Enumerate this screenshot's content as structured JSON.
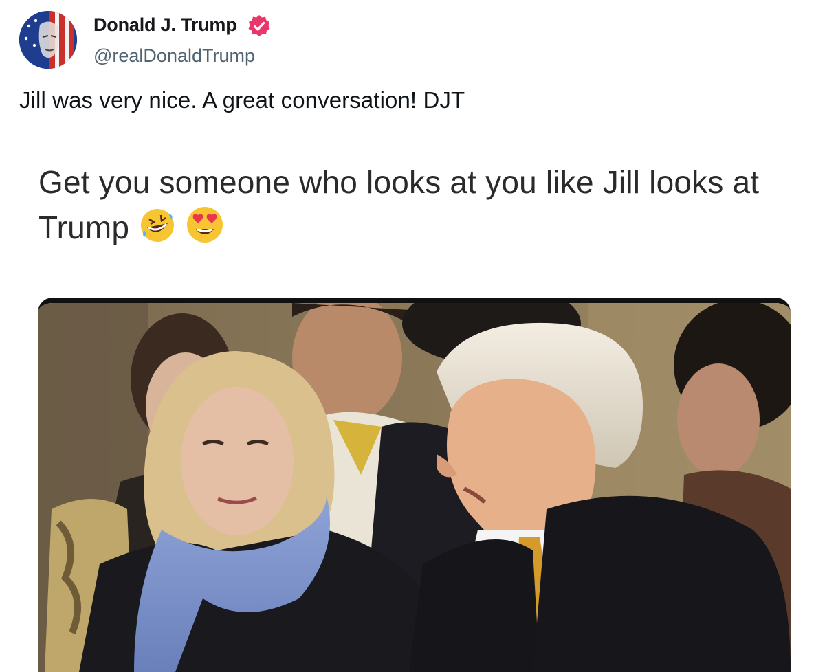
{
  "post": {
    "display_name": "Donald J. Trump",
    "handle": "@realDonaldTrump",
    "verified": true,
    "text": "Jill was very nice. A great conversation! DJT"
  },
  "meme": {
    "caption": "Get you someone who looks at you like Jill looks at Trump",
    "emojis": [
      "rolling-on-floor-laughing-emoji",
      "heart-eyes-emoji"
    ]
  },
  "colors": {
    "verified_badge": "#e8376b",
    "handle": "#536471"
  }
}
